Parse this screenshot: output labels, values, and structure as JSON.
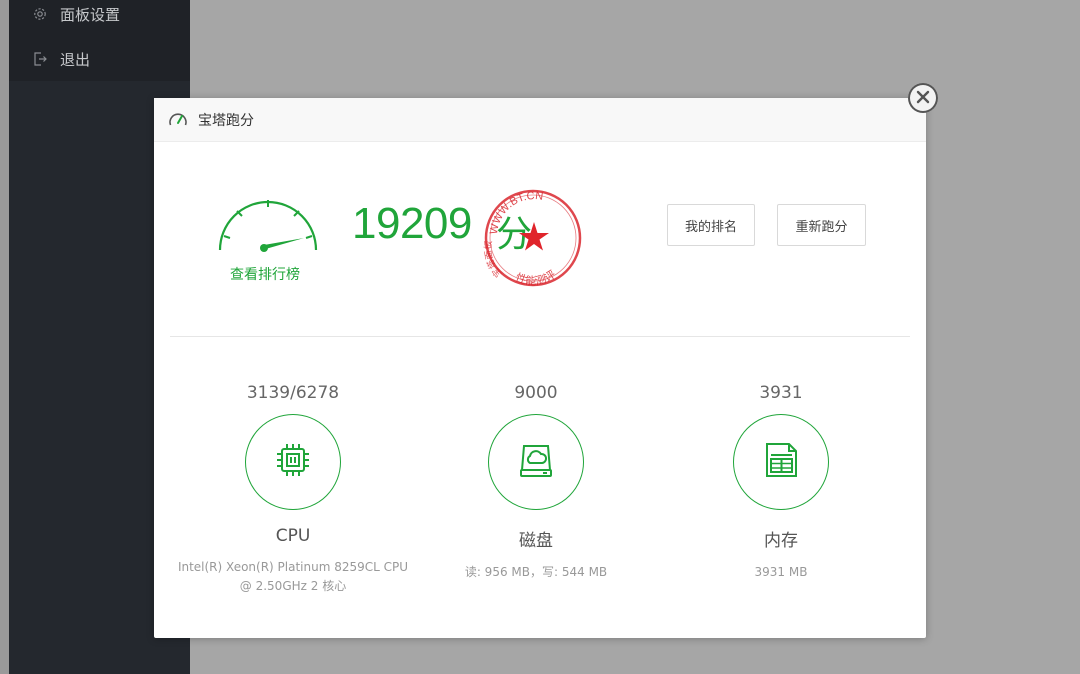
{
  "sidebar": {
    "items": [
      {
        "label": "面板设置",
        "icon": "gear-icon"
      },
      {
        "label": "退出",
        "icon": "logout-icon"
      }
    ]
  },
  "modal": {
    "title": "宝塔跑分",
    "header_icon": "speedometer-icon",
    "rank_link": "查看排行榜",
    "score": "19209",
    "score_unit": "分",
    "buttons": {
      "my_rank": "我的排名",
      "retest": "重新跑分"
    },
    "stamp": {
      "top_text": "WWW.BT.CN",
      "left_text": "宝塔面板",
      "bottom_text": "性能测评"
    },
    "metrics": [
      {
        "score": "3139/6278",
        "name": "CPU",
        "desc_lines": [
          "Intel(R) Xeon(R) Platinum 8259CL CPU",
          "@ 2.50GHz 2 核心"
        ],
        "icon": "cpu-chip-icon"
      },
      {
        "score": "9000",
        "name": "磁盘",
        "desc_lines": [
          "读: 956 MB，写: 544 MB"
        ],
        "icon": "disk-cloud-icon"
      },
      {
        "score": "3931",
        "name": "内存",
        "desc_lines": [
          "3931 MB"
        ],
        "icon": "memory-document-icon"
      }
    ]
  },
  "colors": {
    "accent": "#20a53a",
    "stamp": "#d9272e",
    "sidebar_bg": "#24282e",
    "overlay": "#a6a6a6"
  }
}
